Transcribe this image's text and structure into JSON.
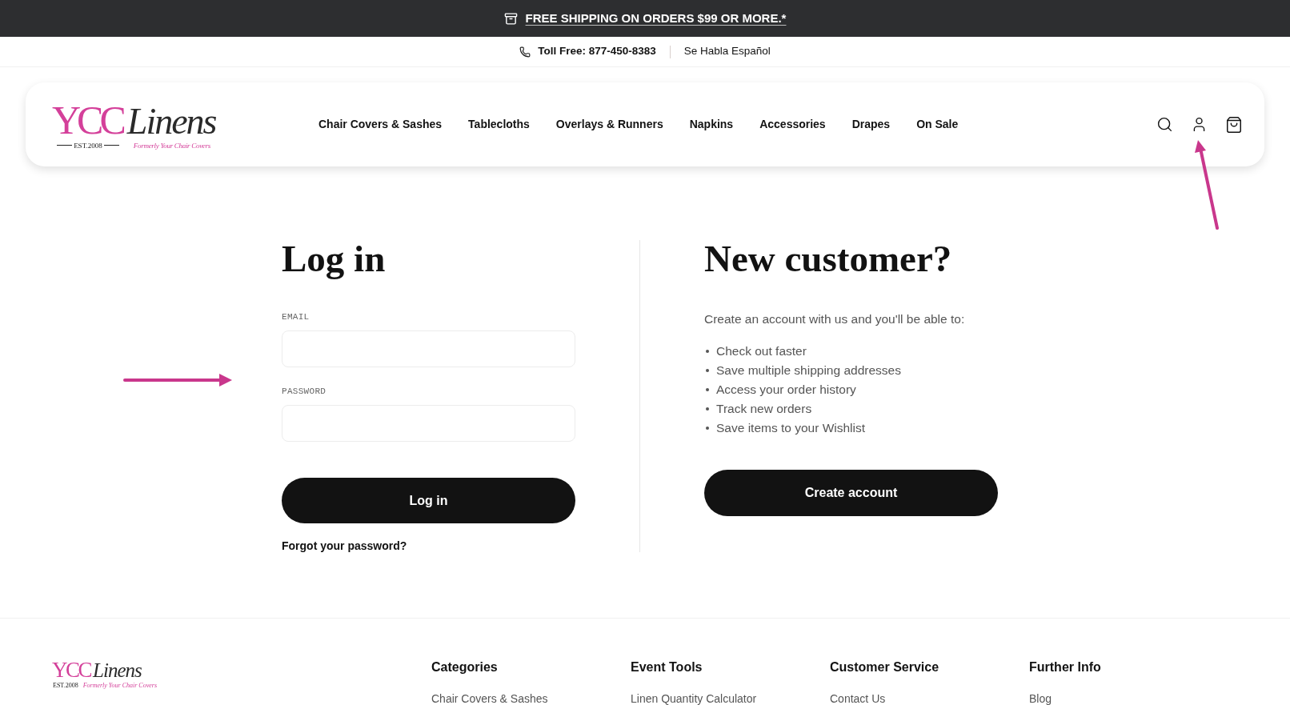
{
  "announcement_bar": {
    "text": "FREE SHIPPING ON ORDERS $99 OR MORE.*"
  },
  "contact_bar": {
    "phone": "Toll Free: 877-450-8383",
    "language_note": "Se Habla Español"
  },
  "header": {
    "logo": {
      "brand": "YCC",
      "script": "Linens",
      "established": "EST.2008",
      "tagline": "Formerly Your Chair Covers"
    },
    "nav": [
      "Chair Covers & Sashes",
      "Tablecloths",
      "Overlays & Runners",
      "Napkins",
      "Accessories",
      "Drapes",
      "On Sale"
    ]
  },
  "login": {
    "title": "Log in",
    "fields": [
      {
        "label": "EMAIL"
      },
      {
        "label": "PASSWORD"
      }
    ],
    "submit_button": "Log in",
    "forgot_link": "Forgot your password?"
  },
  "new_customer": {
    "title": "New customer?",
    "intro": "Create an account with us and you'll be able to:",
    "benefits": [
      "Check out faster",
      "Save multiple shipping addresses",
      "Access your order history",
      "Track new orders",
      "Save items to your Wishlist"
    ],
    "button": "Create account"
  },
  "footer": {
    "logo": {
      "brand": "YCC",
      "script": "Linens",
      "established": "EST.2008",
      "tagline": "Formerly Your Chair Covers"
    },
    "columns": [
      {
        "heading": "Categories",
        "links": [
          "Chair Covers & Sashes"
        ]
      },
      {
        "heading": "Event Tools",
        "links": [
          "Linen Quantity Calculator"
        ]
      },
      {
        "heading": "Customer Service",
        "links": [
          "Contact Us"
        ]
      },
      {
        "heading": "Further Info",
        "links": [
          "Blog"
        ]
      }
    ]
  }
}
